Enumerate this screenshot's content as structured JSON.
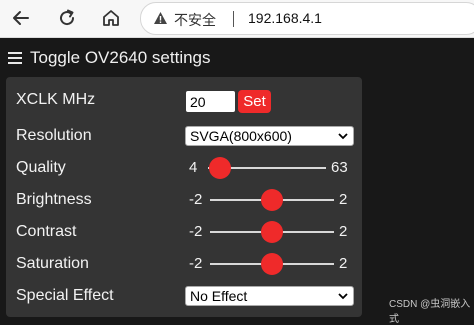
{
  "browser": {
    "security_label": "不安全",
    "url": "192.168.4.1",
    "back_icon": "back-arrow-icon",
    "reload_icon": "reload-icon",
    "home_icon": "home-icon",
    "warning_icon": "warning-icon"
  },
  "toggle": {
    "label": "Toggle OV2640 settings",
    "icon": "hamburger-menu-icon"
  },
  "settings": {
    "xclk": {
      "label": "XCLK MHz",
      "value": "20",
      "button": "Set"
    },
    "resolution": {
      "label": "Resolution",
      "selected": "SVGA(800x600)"
    },
    "quality": {
      "label": "Quality",
      "min": "4",
      "max": "63",
      "value": 10
    },
    "brightness": {
      "label": "Brightness",
      "min": "-2",
      "max": "2",
      "value": 0
    },
    "contrast": {
      "label": "Contrast",
      "min": "-2",
      "max": "2",
      "value": 0
    },
    "saturation": {
      "label": "Saturation",
      "min": "-2",
      "max": "2",
      "value": 0
    },
    "special_effect": {
      "label": "Special Effect",
      "selected": "No Effect"
    }
  },
  "watermark": "CSDN @虫洞嵌入式",
  "colors": {
    "accent": "#ef2a2a",
    "panel": "#343434",
    "background": "#181818"
  }
}
